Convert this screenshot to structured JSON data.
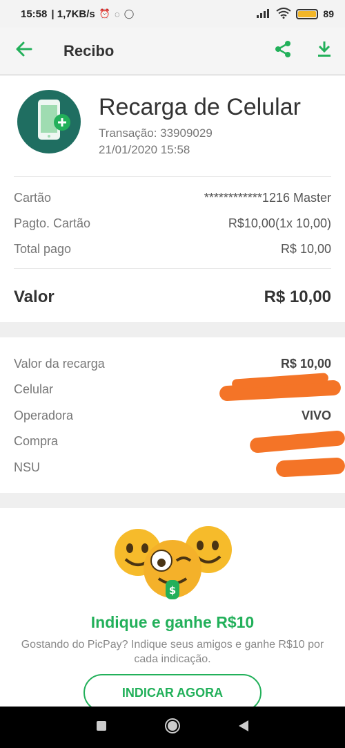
{
  "status_bar": {
    "time": "15:58",
    "speed": "| 1,7KB/s",
    "battery": "89"
  },
  "app_bar": {
    "title": "Recibo",
    "back_icon": "arrow-left-icon",
    "share_icon": "share-icon",
    "download_icon": "download-icon"
  },
  "receipt": {
    "title": "Recarga de Celular",
    "transaction": "Transação: 33909029",
    "datetime": "21/01/2020 15:58",
    "rows": [
      {
        "label": "Cartão",
        "value": "************1216 Master"
      },
      {
        "label": "Pagto. Cartão",
        "value": "R$10,00(1x 10,00)"
      },
      {
        "label": "Total pago",
        "value": "R$ 10,00"
      }
    ],
    "total": {
      "label": "Valor",
      "value": "R$ 10,00"
    }
  },
  "details": {
    "rows": [
      {
        "label": "Valor da recarga",
        "value": "R$ 10,00"
      },
      {
        "label": "Celular",
        "value": ""
      },
      {
        "label": "Operadora",
        "value": "VIVO"
      },
      {
        "label": "Compra",
        "value": ""
      },
      {
        "label": "NSU",
        "value": ""
      }
    ]
  },
  "promo": {
    "title": "Indique e ganhe R$10",
    "text": "Gostando do PicPay? Indique seus amigos e ganhe R$10 por cada indicação.",
    "button": "INDICAR AGORA"
  },
  "colors": {
    "brand_green": "#22b05a",
    "icon_circle": "#1f6e61",
    "redaction": "#f47427"
  }
}
